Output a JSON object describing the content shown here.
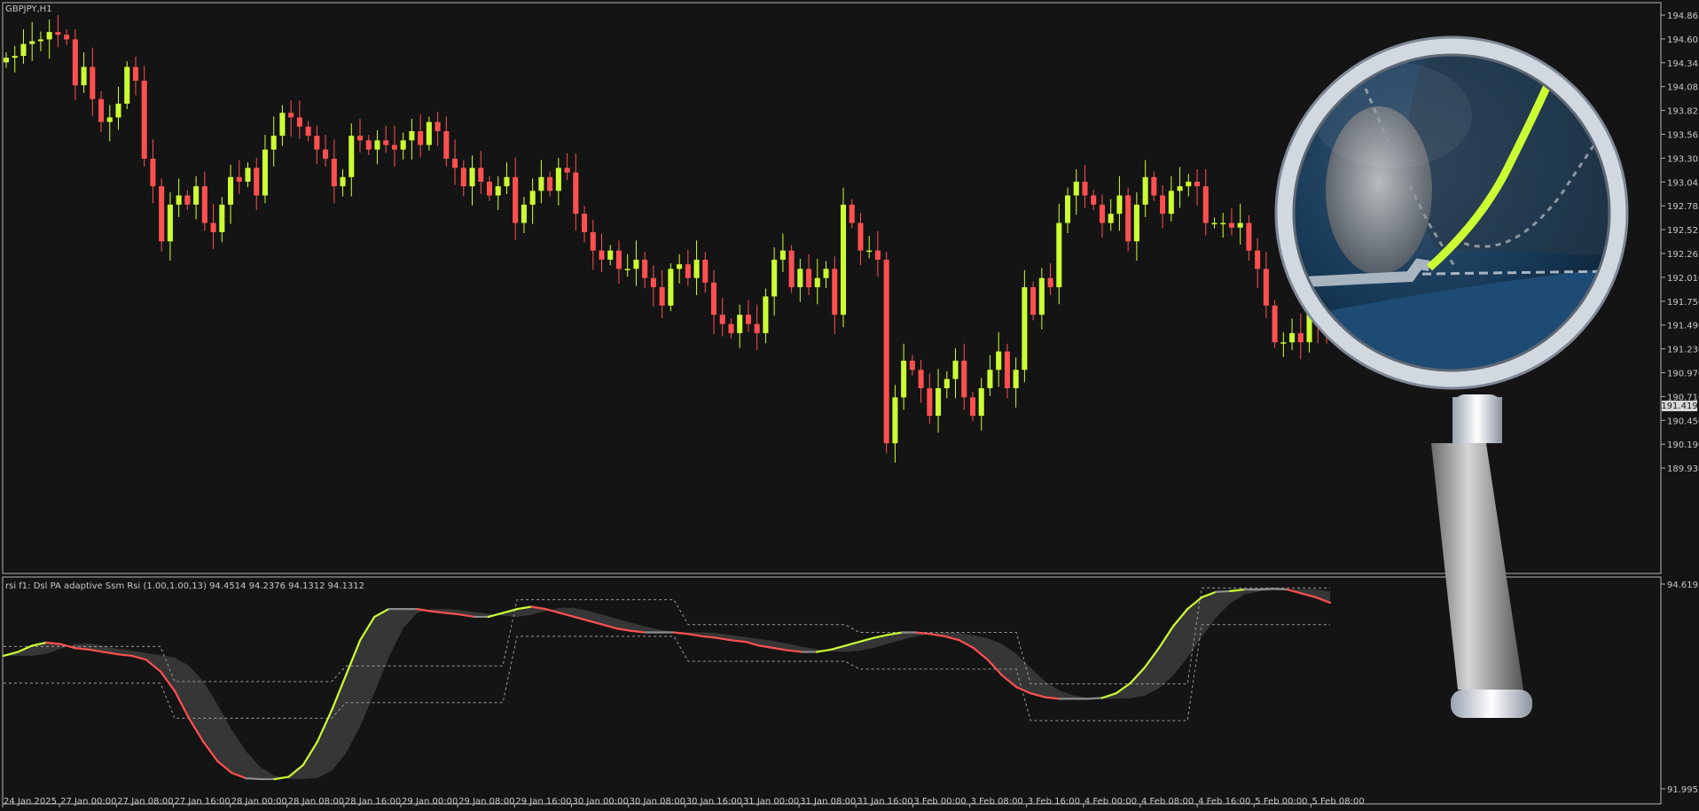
{
  "chart_window": {
    "symbol_label": "GBPJPY,H1",
    "indicator_label": "rsi f1: Dsl PA adaptive Ssm Rsi (1.00,1.00,13) 94.4514 94.2376 94.1312 94.1312",
    "current_price": "191.419"
  },
  "colors": {
    "background": "#141414",
    "frame": "#b4b4b4",
    "bull": "#ccff33",
    "bear": "#ff5050",
    "neutral": "#8c8c8c",
    "band": "#3a3a3a",
    "text": "#c8c8c8"
  },
  "price_axis": {
    "ticks": [
      "194.865",
      "194.605",
      "194.345",
      "194.085",
      "193.825",
      "193.565",
      "193.305",
      "193.045",
      "192.785",
      "192.525",
      "192.265",
      "192.010",
      "191.750",
      "191.490",
      "191.230",
      "190.970",
      "190.710",
      "190.450",
      "190.190",
      "189.930"
    ]
  },
  "indicator_axis": {
    "ticks": [
      "94.6195",
      "91.9955"
    ]
  },
  "time_axis": {
    "ticks": [
      "24 Jan 2025",
      "27 Jan 00:00",
      "27 Jan 08:00",
      "27 Jan 16:00",
      "28 Jan 00:00",
      "28 Jan 08:00",
      "28 Jan 16:00",
      "29 Jan 00:00",
      "29 Jan 08:00",
      "29 Jan 16:00",
      "30 Jan 00:00",
      "30 Jan 08:00",
      "30 Jan 16:00",
      "31 Jan 00:00",
      "31 Jan 08:00",
      "31 Jan 16:00",
      "3 Feb 00:00",
      "3 Feb 08:00",
      "3 Feb 16:00",
      "4 Feb 00:00",
      "4 Feb 08:00",
      "4 Feb 16:00",
      "5 Feb 00:00",
      "5 Feb 08:00"
    ]
  },
  "magnifier": {
    "icon": "magnifying-glass-icon"
  },
  "chart_data": [
    {
      "type": "candlestick",
      "symbol": "GBPJPY",
      "timeframe": "H1",
      "ylim": [
        189.93,
        194.865
      ],
      "closes": [
        194.4,
        194.42,
        194.55,
        194.58,
        194.6,
        194.68,
        194.65,
        194.6,
        194.1,
        194.3,
        193.95,
        193.7,
        193.75,
        193.9,
        194.3,
        194.15,
        193.3,
        193.0,
        192.4,
        192.8,
        192.9,
        192.8,
        193.0,
        192.6,
        192.5,
        192.8,
        193.1,
        193.05,
        193.2,
        192.9,
        193.4,
        193.55,
        193.8,
        193.75,
        193.65,
        193.55,
        193.4,
        193.3,
        193.0,
        193.1,
        193.55,
        193.5,
        193.4,
        193.5,
        193.45,
        193.4,
        193.5,
        193.6,
        193.45,
        193.7,
        193.6,
        193.3,
        193.2,
        193.0,
        193.2,
        193.05,
        192.9,
        193.0,
        193.1,
        192.6,
        192.8,
        192.95,
        193.1,
        192.95,
        193.2,
        193.15,
        192.7,
        192.5,
        192.3,
        192.2,
        192.3,
        192.1,
        192.1,
        192.2,
        192.0,
        191.9,
        191.7,
        192.1,
        192.15,
        192.0,
        192.2,
        191.95,
        191.6,
        191.5,
        191.4,
        191.6,
        191.5,
        191.4,
        191.8,
        192.2,
        192.3,
        191.9,
        192.1,
        191.9,
        192.0,
        192.1,
        191.6,
        192.8,
        192.6,
        192.3,
        192.3,
        192.2,
        190.2,
        190.7,
        191.1,
        191.0,
        190.8,
        190.5,
        190.8,
        190.9,
        191.1,
        190.7,
        190.5,
        190.8,
        191.0,
        191.2,
        190.8,
        191.0,
        191.9,
        191.6,
        192.0,
        191.9,
        192.6,
        192.9,
        193.05,
        192.9,
        192.8,
        192.6,
        192.7,
        192.9,
        192.4,
        192.8,
        193.1,
        192.9,
        192.7,
        192.95,
        193.0,
        193.05,
        193.0,
        192.6,
        192.6,
        192.6,
        192.55,
        192.6,
        192.3,
        192.1,
        191.7,
        191.3,
        191.3,
        191.4,
        191.3,
        191.7,
        191.5,
        191.42
      ]
    },
    {
      "type": "line",
      "name": "rsi f1: Dsl PA adaptive Ssm Rsi (1.00,1.00,13)",
      "ylim": [
        91.9955,
        94.6195
      ],
      "values": [
        93.7,
        93.75,
        93.83,
        93.87,
        93.85,
        93.8,
        93.78,
        93.75,
        93.72,
        93.7,
        93.65,
        93.5,
        93.25,
        92.9,
        92.6,
        92.35,
        92.2,
        92.13,
        92.12,
        92.12,
        92.15,
        92.3,
        92.6,
        93.0,
        93.45,
        93.9,
        94.2,
        94.3,
        94.3,
        94.3,
        94.27,
        94.25,
        94.23,
        94.2,
        94.2,
        94.25,
        94.3,
        94.33,
        94.3,
        94.25,
        94.2,
        94.15,
        94.1,
        94.05,
        94.02,
        94.0,
        94.0,
        94.0,
        93.98,
        93.95,
        93.93,
        93.9,
        93.88,
        93.83,
        93.8,
        93.77,
        93.75,
        93.75,
        93.78,
        93.83,
        93.88,
        93.93,
        93.97,
        94.0,
        94.0,
        93.98,
        93.95,
        93.9,
        93.8,
        93.65,
        93.45,
        93.3,
        93.22,
        93.17,
        93.15,
        93.15,
        93.15,
        93.16,
        93.22,
        93.35,
        93.55,
        93.8,
        94.08,
        94.3,
        94.45,
        94.52,
        94.53,
        94.55,
        94.55,
        94.56,
        94.55,
        94.5,
        94.45,
        94.38
      ]
    }
  ]
}
